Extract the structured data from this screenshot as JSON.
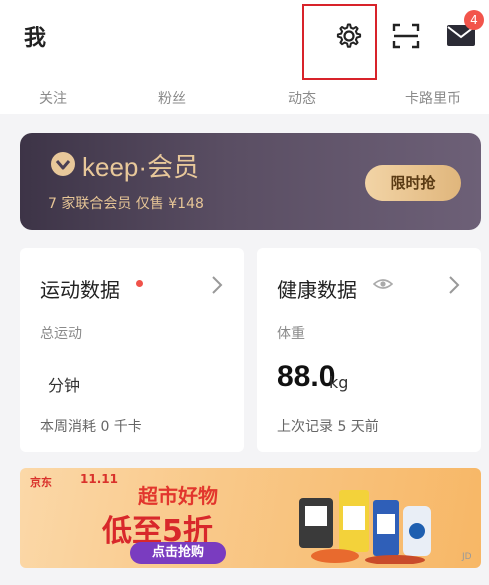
{
  "topbar": {
    "title": "我",
    "mail_badge": "4"
  },
  "stats": {
    "items": [
      {
        "label": "关注"
      },
      {
        "label": "粉丝"
      },
      {
        "label": "动态"
      },
      {
        "label": "卡路里币"
      }
    ]
  },
  "membership": {
    "brand": "keep·会员",
    "subtitle": "7 家联合会员 仅售 ¥148",
    "button_label": "限时抢"
  },
  "sports_card": {
    "title": "运动数据",
    "label": "总运动",
    "unit": "分钟",
    "footer": "本周消耗 0 千卡"
  },
  "health_card": {
    "title": "健康数据",
    "label": "体重",
    "value": "88.0",
    "unit": "kg",
    "footer": "上次记录 5 天前"
  },
  "banner": {
    "jd_label": "京东",
    "event_label": "11.11",
    "subtitle": "超市好物",
    "headline": "低至5折",
    "button_label": "点击抢购",
    "corner_label": "JD"
  },
  "colors": {
    "accent_red": "#f2544b",
    "member_gold": "#e6c596",
    "member_bg": "#4a4054"
  }
}
